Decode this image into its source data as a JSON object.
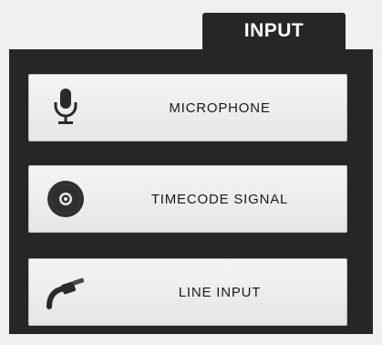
{
  "tab": {
    "label": "INPUT"
  },
  "options": [
    {
      "label": "MICROPHONE",
      "icon": "microphone-icon"
    },
    {
      "label": "TIMECODE SIGNAL",
      "icon": "vinyl-disc-icon"
    },
    {
      "label": "LINE INPUT",
      "icon": "audio-cable-icon"
    }
  ],
  "colors": {
    "panel": "#262626",
    "button_face": "#ececec",
    "text": "#1a1a1a",
    "tab_text": "#ffffff"
  }
}
